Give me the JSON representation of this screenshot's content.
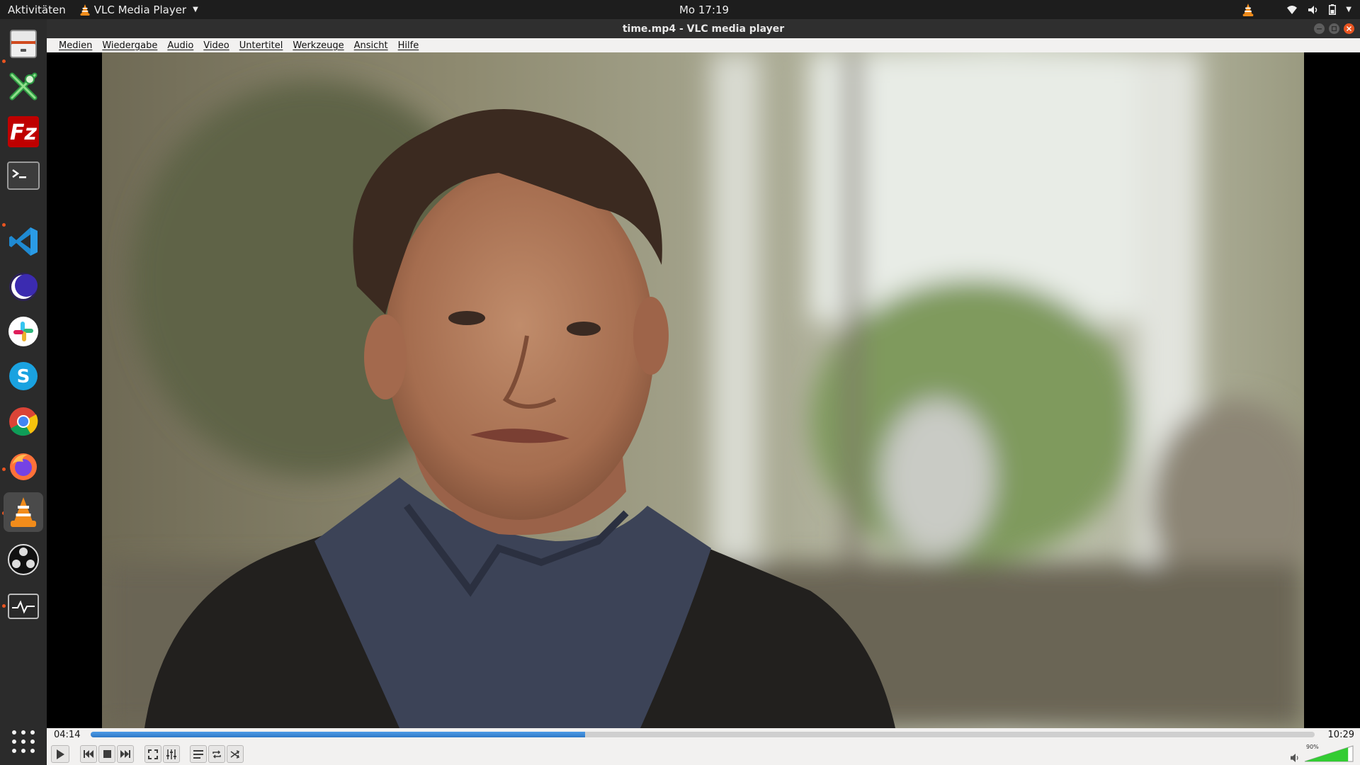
{
  "topbar": {
    "activities": "Aktivitäten",
    "app_name": "VLC Media Player",
    "clock": "Mo 17:19"
  },
  "dock": {
    "items": [
      {
        "name": "files-app",
        "icon": "file-cabinet-icon",
        "running": false,
        "active": false
      },
      {
        "name": "network-tool",
        "icon": "x-cross-network-icon",
        "running": true,
        "active": false
      },
      {
        "name": "filezilla",
        "icon": "filezilla-icon",
        "running": false,
        "active": false
      },
      {
        "name": "terminal",
        "icon": "terminal-icon",
        "running": false,
        "active": false
      },
      {
        "name": "vscode",
        "icon": "vscode-icon",
        "running": true,
        "active": false
      },
      {
        "name": "eclipse",
        "icon": "eclipse-icon",
        "running": false,
        "active": false
      },
      {
        "name": "slack",
        "icon": "slack-icon",
        "running": false,
        "active": false
      },
      {
        "name": "skype",
        "icon": "skype-icon",
        "running": false,
        "active": false
      },
      {
        "name": "chrome",
        "icon": "chrome-icon",
        "running": false,
        "active": false
      },
      {
        "name": "firefox",
        "icon": "firefox-icon",
        "running": true,
        "active": false
      },
      {
        "name": "vlc",
        "icon": "vlc-cone-icon",
        "running": true,
        "active": true
      },
      {
        "name": "obs",
        "icon": "obs-icon",
        "running": false,
        "active": false
      },
      {
        "name": "system-monitor",
        "icon": "system-monitor-icon",
        "running": true,
        "active": false
      }
    ],
    "show_apps_icon": "app-grid-icon"
  },
  "window": {
    "title": "time.mp4 - VLC media player"
  },
  "menu": {
    "items": [
      "Medien",
      "Wiedergabe",
      "Audio",
      "Video",
      "Untertitel",
      "Werkzeuge",
      "Ansicht",
      "Hilfe"
    ]
  },
  "player": {
    "elapsed": "04:14",
    "total": "10:29",
    "progress_fraction": 0.404,
    "volume_percent": 90,
    "volume_label": "90%"
  },
  "colors": {
    "accent": "#e95420",
    "seek": "#3a86d6",
    "volume": "#33cc33"
  }
}
